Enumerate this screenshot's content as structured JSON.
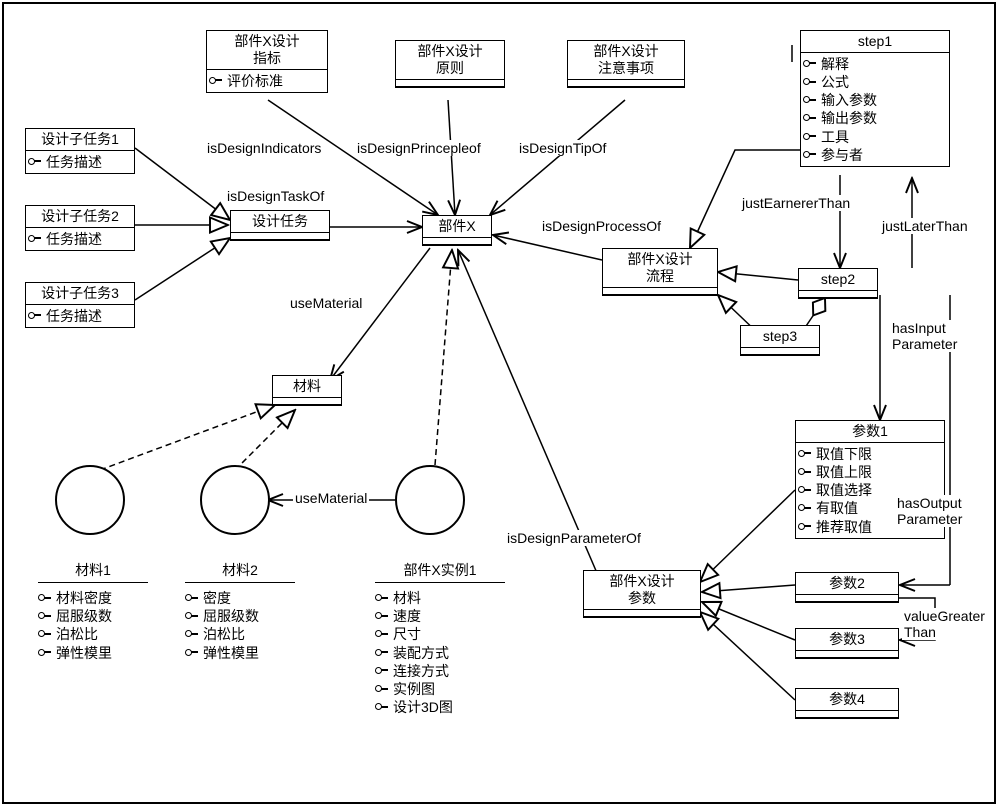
{
  "diagram": {
    "outer": true,
    "labels": {
      "isDesignIndicators": "isDesignIndicators",
      "isDesignPrincepleof": "isDesignPrincepleof",
      "isDesignTipOf": "isDesignTipOf",
      "isDesignTaskOf": "isDesignTaskOf",
      "isDesignProcessOf": "isDesignProcessOf",
      "justEarnererThan": "justEarnererThan",
      "justLaterThan": "justLaterThan",
      "hasInputParameter": "hasInput\nParameter",
      "hasOutputParameter": "hasOutput\nParameter",
      "useMaterial_top": "useMaterial",
      "useMaterial_bottom": "useMaterial",
      "isDesignParameterOf": "isDesignParameterOf",
      "valueGreaterThan": "valueGreater\nThan"
    },
    "boxes": {
      "componentX": {
        "title": "部件X"
      },
      "designTask": {
        "title": "设计任务"
      },
      "indicators": {
        "title": "部件X设计\n指标",
        "attrs": [
          "评价标准"
        ]
      },
      "principle": {
        "title": "部件X设计\n原则"
      },
      "tips": {
        "title": "部件X设计\n注意事项"
      },
      "process": {
        "title": "部件X设计\n流程"
      },
      "subtask1": {
        "title": "设计子任务1",
        "attrs": [
          "任务描述"
        ]
      },
      "subtask2": {
        "title": "设计子任务2",
        "attrs": [
          "任务描述"
        ]
      },
      "subtask3": {
        "title": "设计子任务3",
        "attrs": [
          "任务描述"
        ]
      },
      "material": {
        "title": "材料"
      },
      "step1": {
        "title": "step1",
        "attrs": [
          "解释",
          "公式",
          "输入参数",
          "输出参数",
          "工具",
          "参与者"
        ]
      },
      "step2": {
        "title": "step2"
      },
      "step3": {
        "title": "step3"
      },
      "designParam": {
        "title": "部件X设计\n参数"
      },
      "param1": {
        "title": "参数1",
        "attrs": [
          "取值下限",
          "取值上限",
          "取值选择",
          "有取值",
          "推荐取值"
        ]
      },
      "param2": {
        "title": "参数2"
      },
      "param3": {
        "title": "参数3"
      },
      "param4": {
        "title": "参数4"
      }
    },
    "instances": {
      "material1": {
        "name": "材料1",
        "attrs": [
          "材料密度",
          "屈服级数",
          "泊松比",
          "弹性模里"
        ]
      },
      "material2": {
        "name": "材料2",
        "attrs": [
          "密度",
          "屈服级数",
          "泊松比",
          "弹性模里"
        ]
      },
      "componentXInst": {
        "name": "部件X实例1",
        "attrs": [
          "材料",
          "速度",
          "尺寸",
          "装配方式",
          "连接方式",
          "实例图",
          "设计3D图"
        ]
      }
    }
  }
}
